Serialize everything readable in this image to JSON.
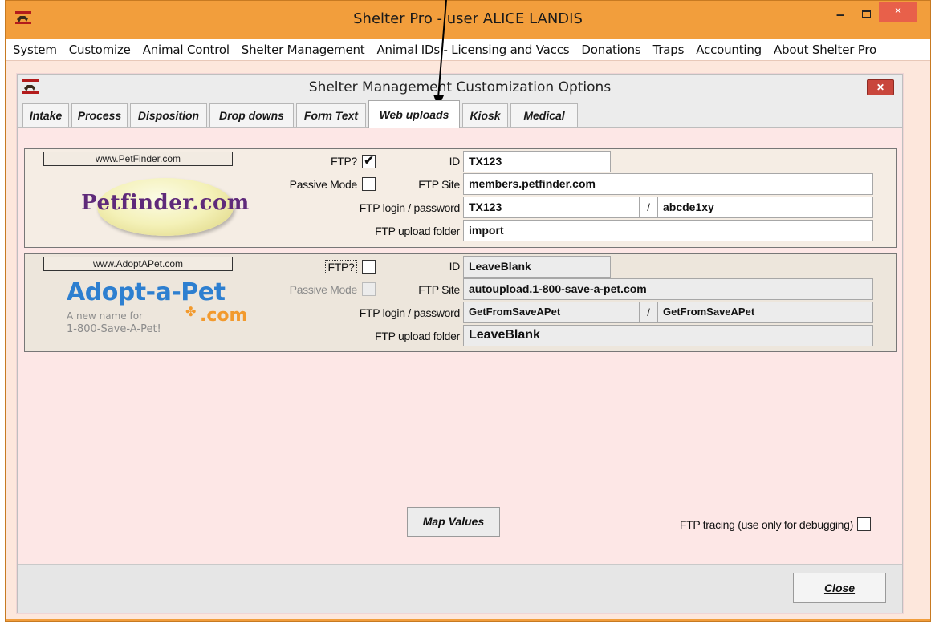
{
  "window": {
    "title": "Shelter Pro - user ALICE LANDIS",
    "minimize_glyph": "–",
    "close_glyph": "×"
  },
  "menu": [
    {
      "label": "System"
    },
    {
      "label": "Customize"
    },
    {
      "label": "Animal Control"
    },
    {
      "label": "Shelter Management"
    },
    {
      "label": "Animal IDs - Licensing and Vaccs"
    },
    {
      "label": "Donations"
    },
    {
      "label": "Traps"
    },
    {
      "label": "Accounting"
    },
    {
      "label": "About Shelter Pro"
    }
  ],
  "dialog": {
    "title": "Shelter Management Customization Options",
    "close_glyph": "✕",
    "tabs": [
      {
        "label": "Intake"
      },
      {
        "label": "Process"
      },
      {
        "label": "Disposition"
      },
      {
        "label": "Drop downs"
      },
      {
        "label": "Form Text"
      },
      {
        "label": "Web uploads"
      },
      {
        "label": "Kiosk"
      },
      {
        "label": "Medical"
      }
    ],
    "active_tab": "Web uploads"
  },
  "petfinder": {
    "link": "www.PetFinder.com",
    "logo_text": "Petfinder.com",
    "ftp_label": "FTP?",
    "ftp_checked": true,
    "check_glyph": "✔",
    "passive_label": "Passive Mode",
    "passive_checked": false,
    "id_label": "ID",
    "id_value": "TX123",
    "site_label": "FTP Site",
    "site_value": "members.petfinder.com",
    "login_label": "FTP login / password",
    "login_value": "TX123",
    "slash": "/",
    "password_value": "abcde1xy",
    "folder_label": "FTP upload folder",
    "folder_value": "import"
  },
  "adoptapet": {
    "link": "www.AdoptAPet.com",
    "logo_title": "Adopt-a-Pet",
    "logo_sub": "A new name for",
    "logo_com": ".com",
    "logo_phone": "1-800-Save-A-Pet!",
    "ftp_label": "FTP?",
    "ftp_checked": false,
    "passive_label": "Passive Mode",
    "passive_checked": false,
    "id_label": "ID",
    "id_value": "LeaveBlank",
    "site_label": "FTP Site",
    "site_value": "autoupload.1-800-save-a-pet.com",
    "login_label": "FTP login / password",
    "login_value": "GetFromSaveAPet",
    "slash": "/",
    "password_value": "GetFromSaveAPet",
    "folder_label": "FTP upload folder",
    "folder_value": "LeaveBlank"
  },
  "actions": {
    "map_values": "Map Values",
    "ftp_tracing_label": "FTP tracing (use only for debugging)",
    "ftp_tracing_checked": false,
    "close": "Close"
  },
  "colors": {
    "outer_frame": "#f29e3c",
    "panel_bg": "#fde7e6",
    "title_close": "#e8604a"
  }
}
